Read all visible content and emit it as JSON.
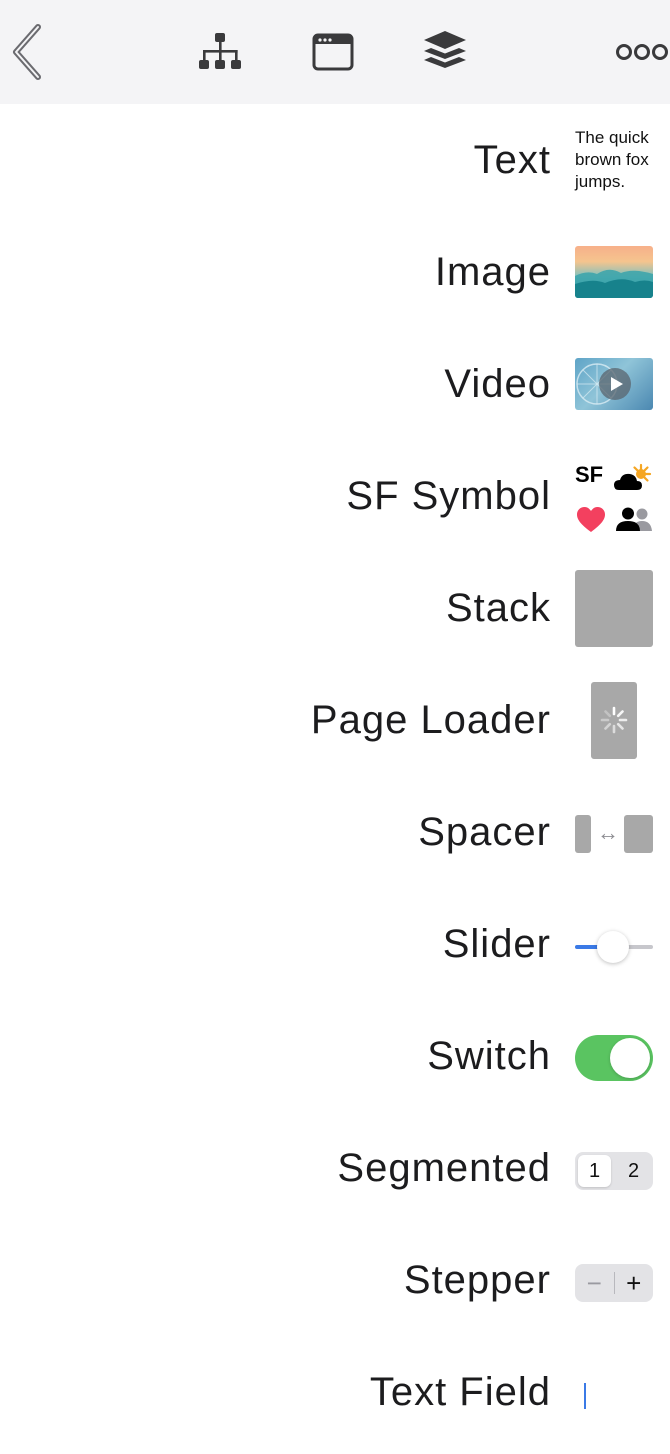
{
  "toolbar": {
    "back_icon": "chevron-left-icon",
    "hierarchy_icon": "hierarchy-icon",
    "window_icon": "window-icon",
    "layers_icon": "layers-icon",
    "more_icon": "more-icon"
  },
  "components": [
    {
      "label": "Text",
      "preview_text": "The quick\nbrown fox\njumps."
    },
    {
      "label": "Image"
    },
    {
      "label": "Video"
    },
    {
      "label": "SF Symbol",
      "preview_text": "SF"
    },
    {
      "label": "Stack"
    },
    {
      "label": "Page Loader"
    },
    {
      "label": "Spacer",
      "preview_text": "↔"
    },
    {
      "label": "Slider",
      "value": 0.48
    },
    {
      "label": "Switch",
      "value": "on"
    },
    {
      "label": "Segmented",
      "segments": [
        "1",
        "2"
      ],
      "selected": "1"
    },
    {
      "label": "Stepper",
      "minus": "−",
      "plus": "+"
    },
    {
      "label": "Text Field"
    }
  ],
  "colors": {
    "toolbar_bg": "#f4f4f6",
    "accent_blue": "#3b7ae6",
    "switch_on": "#5ac461",
    "placeholder_gray": "#a8a8a8",
    "heart_red": "#f3405f",
    "sun_orange": "#f5a623"
  }
}
